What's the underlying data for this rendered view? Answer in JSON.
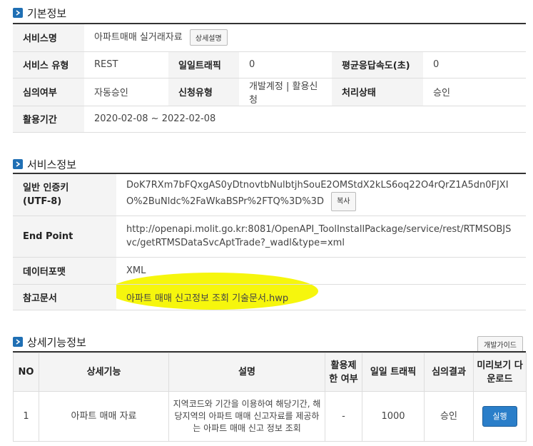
{
  "basic": {
    "title": "기본정보",
    "service_name_label": "서비스명",
    "service_name": "아파트매매 실거래자료",
    "detail_btn": "상세설명",
    "service_type_label": "서비스 유형",
    "service_type": "REST",
    "daily_traffic_label": "일일트래픽",
    "daily_traffic": "0",
    "avg_resp_label": "평균응답속도(초)",
    "avg_resp": "0",
    "review_label": "심의여부",
    "review": "자동승인",
    "apply_type_label": "신청유형",
    "apply_type": "개발계정 | 활용신청",
    "status_label": "처리상태",
    "status": "승인",
    "period_label": "활용기간",
    "period": "2020-02-08 ~ 2022-02-08"
  },
  "service": {
    "title": "서비스정보",
    "key_label_1": "일반 인증키",
    "key_label_2": "(UTF-8)",
    "key": "DoK7RXm7bFQxgAS0yDtnovtbNulbtjhSouE2OMStdX2kLS6oq22O4rQrZ1A5dn0FJXIO%2BuNldc%2FaWkaBSPr%2FTQ%3D%3D",
    "copy_btn": "복사",
    "endpoint_label": "End Point",
    "endpoint": "http://openapi.molit.go.kr:8081/OpenAPI_ToolInstallPackage/service/rest/RTMSOBJSvc/getRTMSDataSvcAptTrade?_wadl&type=xml",
    "format_label": "데이터포맷",
    "format": "XML",
    "ref_label": "참고문서",
    "ref": "아파트 매매 신고정보 조회 기술문서.hwp"
  },
  "detail": {
    "title": "상세기능정보",
    "guide_btn": "개발가이드",
    "headers": [
      "NO",
      "상세기능",
      "설명",
      "활용제한 여부",
      "일일 트래픽",
      "심의결과",
      "미리보기 다운로드"
    ],
    "row": {
      "no": "1",
      "name": "아파트 매매 자료",
      "desc": "지역코드와 기간을 이용하여 해당기간, 해당지역의 아파트 매매 신고자료를 제공하는 아파트 매매 신고 정보 조회",
      "limit": "-",
      "traffic": "1000",
      "result": "승인",
      "run_btn": "실행"
    }
  },
  "colors": {
    "accent": "#1f6fb4",
    "highlight": "#f6f600"
  }
}
